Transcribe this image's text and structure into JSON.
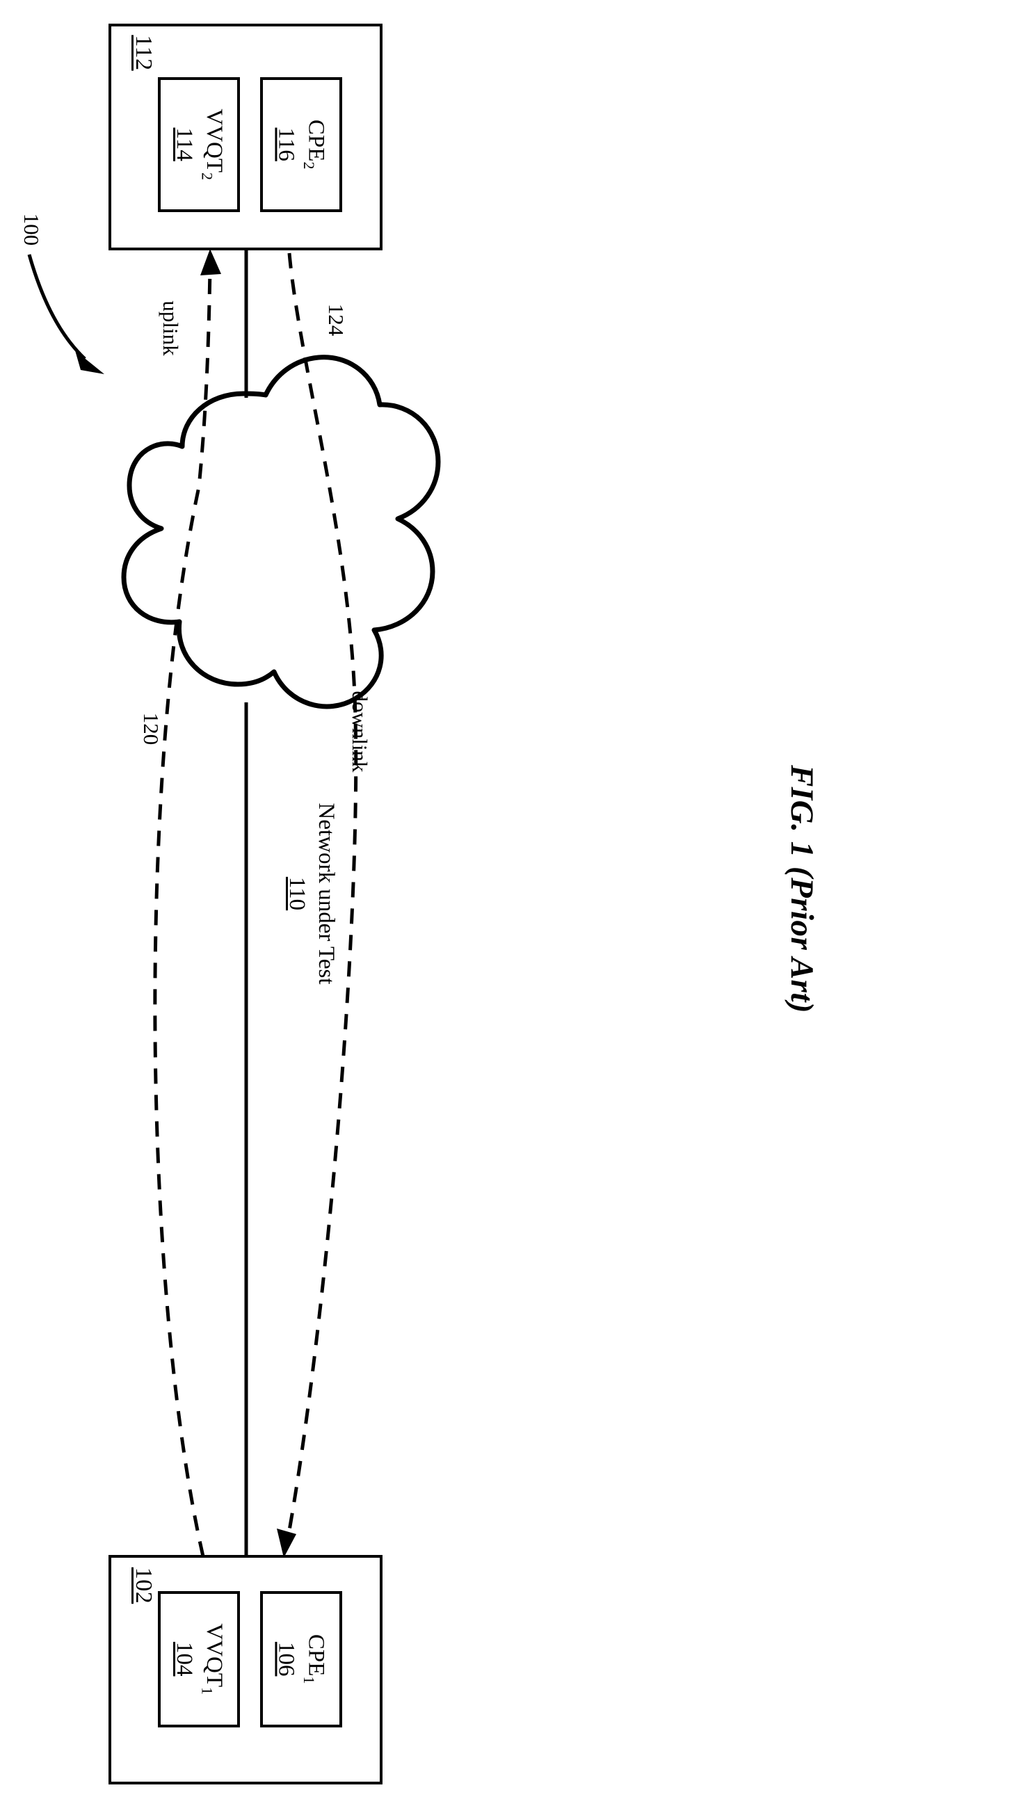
{
  "figure": {
    "caption": "FIG. 1 (Prior Art)",
    "system_ref": "100"
  },
  "endpoints": [
    {
      "id": "top",
      "ref": "112",
      "modules": [
        {
          "name": "VVQT",
          "sub": "2",
          "ref": "114"
        },
        {
          "name": "CPE",
          "sub": "2",
          "ref": "116"
        }
      ]
    },
    {
      "id": "bottom",
      "ref": "102",
      "modules": [
        {
          "name": "VVQT",
          "sub": "1",
          "ref": "104"
        },
        {
          "name": "CPE",
          "sub": "1",
          "ref": "106"
        }
      ]
    }
  ],
  "cloud": {
    "label": "Network under Test",
    "ref": "110"
  },
  "links": [
    {
      "name": "uplink",
      "label": "uplink",
      "ref": "120"
    },
    {
      "name": "downlink",
      "label": "downlink",
      "ref": "124"
    }
  ],
  "colors": {
    "ink": "#000000",
    "paper": "#ffffff"
  }
}
